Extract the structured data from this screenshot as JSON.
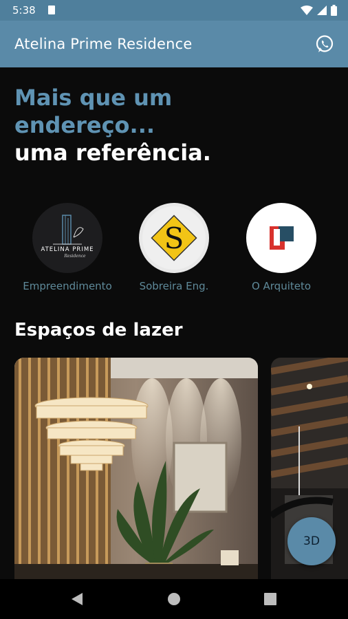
{
  "status_bar": {
    "time": "5:38"
  },
  "app_bar": {
    "title": "Atelina Prime Residence",
    "action_icon": "whatsapp-icon"
  },
  "hero": {
    "line1": "Mais que um",
    "line2": "endereço...",
    "line3": "uma referência."
  },
  "partners": [
    {
      "label": "Empreendimento",
      "logo_text": "ATELINA PRIME",
      "logo_sub": "Residence"
    },
    {
      "label": "Sobreira Eng.",
      "logo_text": "S"
    },
    {
      "label": "O Arquiteto",
      "logo_text": ""
    }
  ],
  "section": {
    "title": "Espaços de lazer"
  },
  "fab": {
    "label": "3D"
  },
  "colors": {
    "accent": "#5a8aa8",
    "hero_blue": "#5f93b3",
    "background": "#0b0b0b"
  }
}
